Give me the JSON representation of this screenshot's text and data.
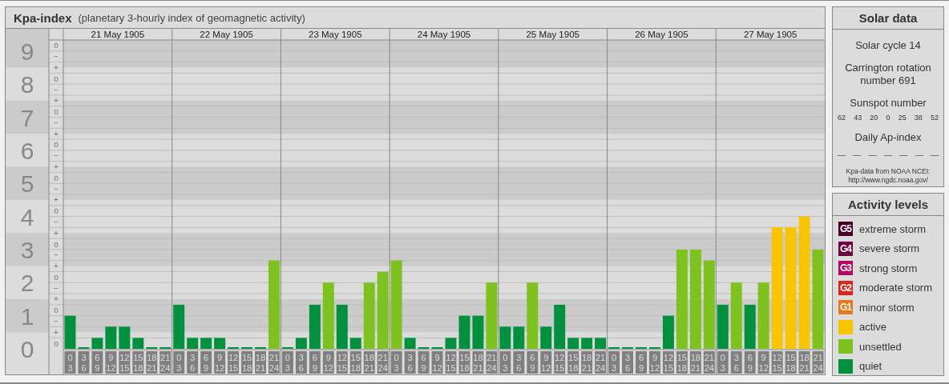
{
  "kp_panel": {
    "title": "Kpa-index",
    "subtitle": "(planetary 3-hourly index of geomagnetic activity)",
    "days": [
      "21 May 1905",
      "22 May 1905",
      "23 May 1905",
      "24 May 1905",
      "25 May 1905",
      "26 May 1905",
      "27 May 1905"
    ],
    "level_marks": [
      "o",
      "−",
      "+",
      "o",
      "−",
      "+",
      "o",
      "−",
      "+",
      "o",
      "−",
      "+",
      "o",
      "−",
      "+",
      "o",
      "−",
      "+",
      "o",
      "−",
      "+",
      "o",
      "−",
      "+",
      "o",
      "−",
      "+",
      "o"
    ],
    "chart_data": {
      "type": "bar",
      "grid": true,
      "ylim": [
        0,
        9
      ],
      "yticks": [
        0,
        1,
        2,
        3,
        4,
        5,
        6,
        7,
        8,
        9
      ],
      "categories": [
        "0 3",
        "3 6",
        "6 9",
        "9 12",
        "12 15",
        "15 18",
        "18 21",
        "21 24",
        "0 3",
        "3 6",
        "6 9",
        "9 12",
        "12 15",
        "15 18",
        "18 21",
        "21 24",
        "0 3",
        "3 6",
        "6 9",
        "9 12",
        "12 15",
        "15 18",
        "18 21",
        "21 24",
        "0 3",
        "3 6",
        "6 9",
        "9 12",
        "12 15",
        "15 18",
        "18 21",
        "21 24",
        "0 3",
        "3 6",
        "6 9",
        "9 12",
        "12 15",
        "15 18",
        "18 21",
        "21 24",
        "0 3",
        "3 6",
        "6 9",
        "9 12",
        "12 15",
        "15 18",
        "18 21",
        "21 24",
        "0 3",
        "3 6",
        "6 9",
        "9 12",
        "12 15",
        "15 18",
        "18 21",
        "21 24"
      ],
      "series": [
        {
          "color": "#00913f",
          "values": [
            1,
            0,
            0.33,
            0.67,
            0.67,
            0.33,
            0,
            0,
            1.33,
            0.33,
            0.33,
            0.33,
            0,
            0,
            0,
            null,
            0,
            0.33,
            1.33,
            null,
            1.33,
            0.33,
            null,
            null,
            null,
            0.33,
            0,
            0,
            0.33,
            1,
            1,
            null,
            0.67,
            0.67,
            null,
            0.67,
            1.33,
            0.33,
            0.33,
            0.33,
            0,
            0,
            0,
            0,
            1,
            null,
            null,
            null,
            1.33,
            null,
            1.33,
            null,
            null,
            null,
            null,
            null
          ]
        },
        {
          "color": "#7dc21e",
          "values": [
            null,
            null,
            null,
            null,
            null,
            null,
            null,
            null,
            null,
            null,
            null,
            null,
            null,
            null,
            null,
            2.67,
            null,
            null,
            null,
            2,
            null,
            null,
            2,
            2.33,
            2.67,
            null,
            null,
            null,
            null,
            null,
            null,
            2,
            null,
            null,
            2,
            null,
            null,
            null,
            null,
            null,
            null,
            null,
            null,
            null,
            null,
            3,
            3,
            2.67,
            null,
            2,
            null,
            2,
            null,
            null,
            null,
            3
          ]
        },
        {
          "color": "#f9c500",
          "values": [
            null,
            null,
            null,
            null,
            null,
            null,
            null,
            null,
            null,
            null,
            null,
            null,
            null,
            null,
            null,
            null,
            null,
            null,
            null,
            null,
            null,
            null,
            null,
            null,
            null,
            null,
            null,
            null,
            null,
            null,
            null,
            null,
            null,
            null,
            null,
            null,
            null,
            null,
            null,
            null,
            null,
            null,
            null,
            null,
            null,
            null,
            null,
            null,
            null,
            null,
            null,
            null,
            3.67,
            3.67,
            4,
            null
          ]
        }
      ]
    }
  },
  "solar_data": {
    "title": "Solar data",
    "solar_cycle": "Solar cycle 14",
    "carrington": "Carrington rotation number 691",
    "sunspot_label": "Sunspot number",
    "sunspot_numbers": [
      "62",
      "43",
      "20",
      "0",
      "25",
      "38",
      "52"
    ],
    "ap_label": "Daily Ap-index",
    "ap_values": [
      "__",
      "__",
      "__",
      "__",
      "__",
      "__",
      "__"
    ],
    "source": "Kpa-data from NOAA NCEI:",
    "source_url": "http://www.ngdc.noaa.gov/"
  },
  "activity_levels": {
    "title": "Activity levels",
    "items": [
      {
        "badge": "G5",
        "label": "extreme storm",
        "color": "#4a0026"
      },
      {
        "badge": "G4",
        "label": "severe storm",
        "color": "#6e0040"
      },
      {
        "badge": "G3",
        "label": "strong storm",
        "color": "#b0075f"
      },
      {
        "badge": "G2",
        "label": "moderate storm",
        "color": "#d9261c"
      },
      {
        "badge": "G1",
        "label": "minor storm",
        "color": "#e8781c"
      },
      {
        "label": "active",
        "color": "#f9c500"
      },
      {
        "label": "unsettled",
        "color": "#7dc21e"
      },
      {
        "label": "quiet",
        "color": "#00913f"
      }
    ]
  }
}
